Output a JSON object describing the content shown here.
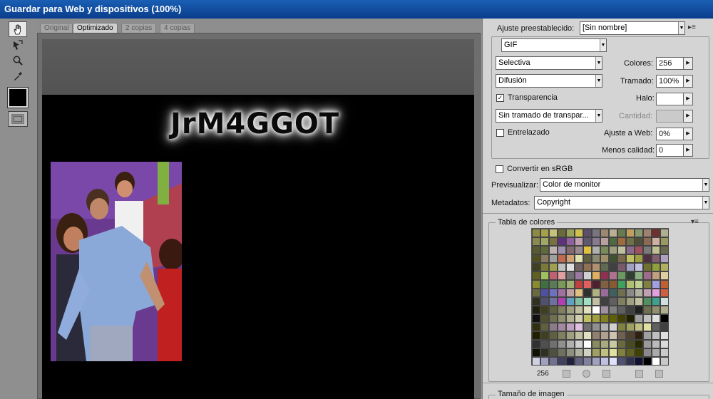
{
  "window": {
    "title": "Guardar para Web y dispositivos (100%)"
  },
  "tools": [
    {
      "name": "hand-tool-icon"
    },
    {
      "name": "slice-select-tool-icon"
    },
    {
      "name": "zoom-tool-icon"
    },
    {
      "name": "eyedropper-tool-icon"
    }
  ],
  "tabs": [
    {
      "label": "Original"
    },
    {
      "label": "Optimizado"
    },
    {
      "label": "2 copias"
    },
    {
      "label": "4 copias"
    }
  ],
  "canvas": {
    "banner_text": "JrM4GGOT"
  },
  "panel": {
    "preset_label": "Ajuste preestablecido:",
    "preset_value": "[Sin nombre]",
    "format_value": "GIF",
    "reduction_value": "Selectiva",
    "dither_algo_value": "Difusión",
    "transparency_label": "Transparencia",
    "transparency_checked": true,
    "trans_dither_value": "Sin tramado de transpar...",
    "interlaced_label": "Entrelazado",
    "interlaced_checked": false,
    "colors_label": "Colores:",
    "colors_value": "256",
    "dither_label": "Tramado:",
    "dither_value": "100%",
    "matte_label": "Halo:",
    "matte_value": "",
    "amount_label": "Cantidad:",
    "amount_value": "",
    "web_snap_label": "Ajuste a Web:",
    "web_snap_value": "0%",
    "lossy_label": "Menos calidad:",
    "lossy_value": "0",
    "srgb_label": "Convertir en sRGB",
    "srgb_checked": false,
    "preview_label": "Previsualizar:",
    "preview_value": "Color de monitor",
    "metadata_label": "Metadatos:",
    "metadata_value": "Copyright"
  },
  "color_table": {
    "title": "Tabla de colores",
    "count": "256",
    "colors": [
      "#8c8a45",
      "#a5a04a",
      "#c7c07a",
      "#6b6a3a",
      "#9aa55a",
      "#d0c050",
      "#5b4f6a",
      "#7a7480",
      "#9b8870",
      "#b8b090",
      "#6a7a50",
      "#c0a060",
      "#8a9a70",
      "#a08070",
      "#703030",
      "#b0b090",
      "#8a8a50",
      "#a0a868",
      "#787040",
      "#603080",
      "#9060a0",
      "#c0a0b0",
      "#605870",
      "#8a7a90",
      "#b8a0a0",
      "#506a40",
      "#a06a40",
      "#707048",
      "#505038",
      "#8a6a50",
      "#d0b0a0",
      "#9a9a60",
      "#5a5a30",
      "#606a3a",
      "#c0b0b0",
      "#a090b0",
      "#806a70",
      "#9a8a90",
      "#e0c040",
      "#b0b0b0",
      "#7a8a5a",
      "#a0a080",
      "#c0c0a0",
      "#8a6a8a",
      "#a05060",
      "#7a7a7a",
      "#c0c090",
      "#6a6a50",
      "#505020",
      "#8a7a60",
      "#a0a0a0",
      "#c06a50",
      "#d0a070",
      "#e0e0b0",
      "#606040",
      "#8a8a70",
      "#a0906a",
      "#405030",
      "#7a6a4a",
      "#c0c060",
      "#a0a040",
      "#503040",
      "#806070",
      "#b0a0c0",
      "#404020",
      "#7a7a3a",
      "#a0a050",
      "#c0c0c0",
      "#e0e0e0",
      "#706060",
      "#907050",
      "#b09070",
      "#606a50",
      "#404040",
      "#7a5a6a",
      "#a0a0c0",
      "#c0c0e0",
      "#707030",
      "#90a040",
      "#b0b060",
      "#606020",
      "#a0c060",
      "#c06070",
      "#e0a0a0",
      "#707070",
      "#9a7aa0",
      "#d0d0d0",
      "#e0b060",
      "#903050",
      "#b07090",
      "#6a9a60",
      "#304030",
      "#8ab080",
      "#a06a8a",
      "#c0a080",
      "#e0d0a0",
      "#8a8a30",
      "#407040",
      "#5a7a5a",
      "#7a9a5a",
      "#a0b070",
      "#c04040",
      "#e06060",
      "#502030",
      "#806040",
      "#8a5a30",
      "#40a060",
      "#b0c070",
      "#c0d090",
      "#808040",
      "#a0a0e0",
      "#c06030",
      "#6a6a40",
      "#5050a0",
      "#7070c0",
      "#a070a0",
      "#c0a0a0",
      "#e0c080",
      "#303030",
      "#b0b080",
      "#9a6a9a",
      "#406060",
      "#707050",
      "#8a8a8a",
      "#b0b0a0",
      "#c0a0b0",
      "#e0a0e0",
      "#d06040",
      "#303020",
      "#505070",
      "#7070a0",
      "#b040b0",
      "#60a0c0",
      "#80c0a0",
      "#a0e0c0",
      "#c0c0a0",
      "#404040",
      "#606060",
      "#808060",
      "#a0a080",
      "#c0c0a0",
      "#509060",
      "#40a090",
      "#d0e0e0",
      "#202010",
      "#404020",
      "#606040",
      "#808060",
      "#a0a080",
      "#c0c0a0",
      "#e0e0c0",
      "#ffffff",
      "#a090a0",
      "#808080",
      "#606060",
      "#404040",
      "#202020",
      "#707050",
      "#909070",
      "#b0b090",
      "#101010",
      "#505030",
      "#707050",
      "#909070",
      "#b0b090",
      "#d0d0b0",
      "#c0c060",
      "#a0a040",
      "#808020",
      "#606000",
      "#404000",
      "#202000",
      "#a0a0a0",
      "#c0c0c0",
      "#e0e0e0",
      "#000000",
      "#303010",
      "#606040",
      "#8a7a8a",
      "#a08aa0",
      "#c0a0c0",
      "#e0c0e0",
      "#707070",
      "#909090",
      "#b0b0b0",
      "#d0d0d0",
      "#808040",
      "#a0a060",
      "#c0c080",
      "#e0e0a0",
      "#606060",
      "#404040",
      "#202000",
      "#404020",
      "#606040",
      "#808060",
      "#a0a080",
      "#c0c0a0",
      "#e0e0c0",
      "#908070",
      "#b0a090",
      "#d0c0b0",
      "#706050",
      "#504030",
      "#302010",
      "#a0a0a0",
      "#c0c0c0",
      "#e0e0e0",
      "#303030",
      "#505050",
      "#707070",
      "#909090",
      "#b0b0b0",
      "#d0d0d0",
      "#ffffff",
      "#8a8a60",
      "#aaaa80",
      "#caca a0",
      "#6a6a40",
      "#4a4a20",
      "#2a2a00",
      "#9a9a9a",
      "#bababa",
      "#dadada",
      "#101000",
      "#303020",
      "#505040",
      "#707060",
      "#909080",
      "#b0b0a0",
      "#d0d0c0",
      "#a0a060",
      "#c0c080",
      "#e0e0a0",
      "#808040",
      "#606020",
      "#404000",
      "#8a8a8a",
      "#aaaaaa",
      "#cacaca",
      "#d0d0e0",
      "#a0a0c0",
      "#707090",
      "#404060",
      "#202040",
      "#606080",
      "#8080a0",
      "#a0a0c0",
      "#c0c0e0",
      "#e0e0ff",
      "#505070",
      "#303050",
      "#101030",
      "#000000",
      "#ffffff",
      "#c8c8c8"
    ]
  },
  "image_size": {
    "title": "Tamaño de imagen"
  }
}
